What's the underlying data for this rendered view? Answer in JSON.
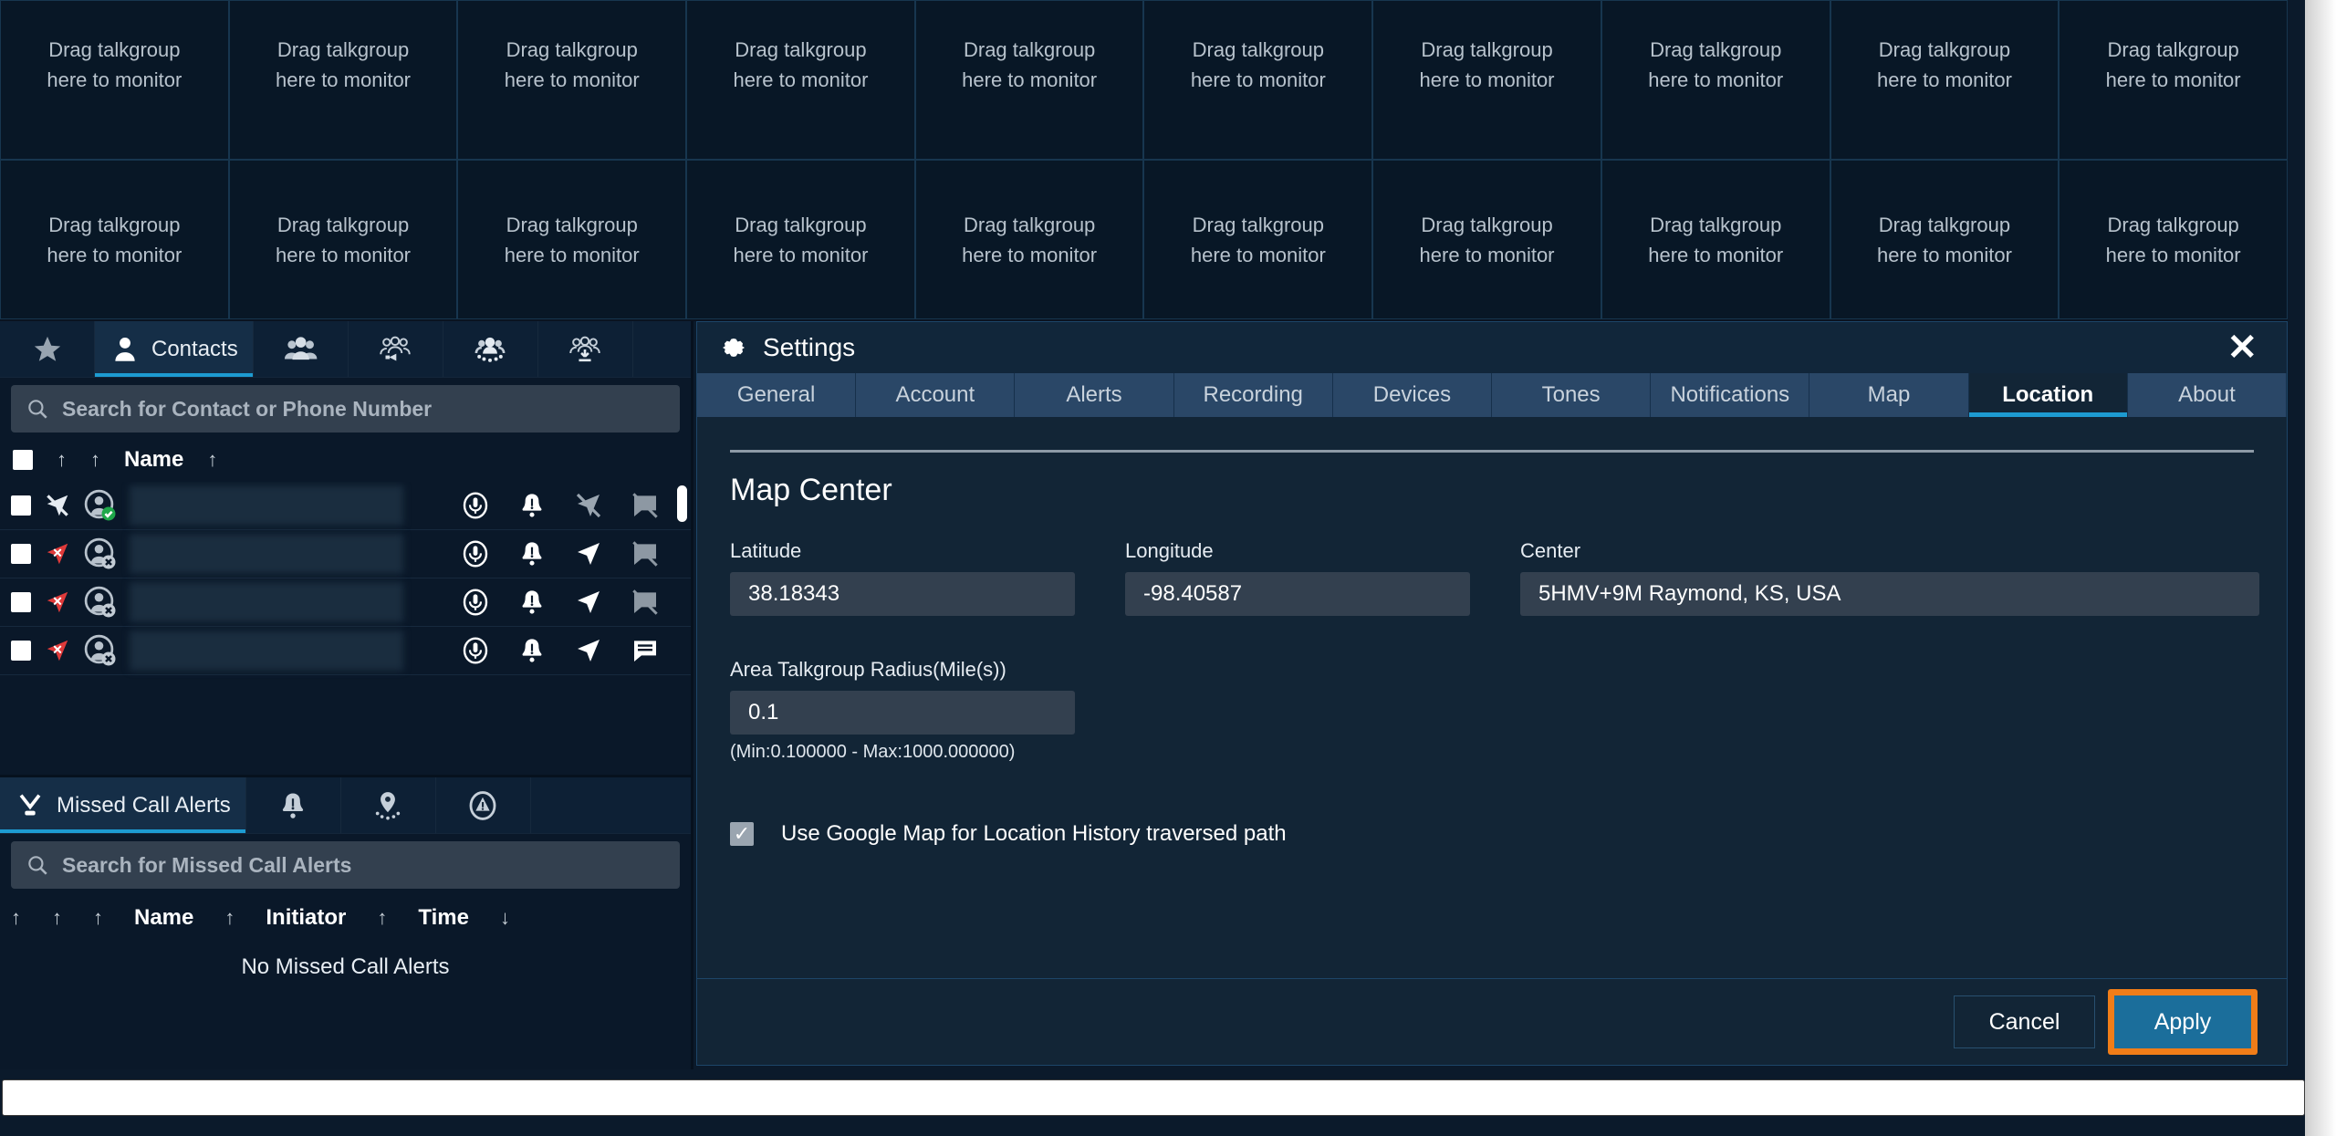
{
  "talkgroup_grid": {
    "placeholder_line1": "Drag talkgroup",
    "placeholder_line2": "here to monitor",
    "columns": 10,
    "rows": 2
  },
  "contacts_panel": {
    "tabs": [
      {
        "label": "",
        "icon": "star-icon",
        "active": false
      },
      {
        "label": "Contacts",
        "icon": "person-icon",
        "active": true
      },
      {
        "label": "",
        "icon": "groups-icon",
        "active": false
      },
      {
        "label": "",
        "icon": "broadcast-group-icon",
        "active": false
      },
      {
        "label": "",
        "icon": "area-talkgroup-icon",
        "active": false
      },
      {
        "label": "",
        "icon": "receive-group-icon",
        "active": false
      }
    ],
    "search": {
      "placeholder": "Search for Contact or Phone Number",
      "value": "",
      "icon": "search-icon"
    },
    "columns": {
      "name": "Name",
      "sort_asc": "↑",
      "sort_desc": "↓"
    },
    "rows": [
      {
        "name": "",
        "presence": "available",
        "nav": "nav-off",
        "chat": "chat-disabled"
      },
      {
        "name": "",
        "presence": "offline",
        "nav": "nav-on",
        "chat": "chat-disabled"
      },
      {
        "name": "",
        "presence": "offline",
        "nav": "nav-on",
        "chat": "chat-disabled"
      },
      {
        "name": "",
        "presence": "offline",
        "nav": "nav-on",
        "chat": "chat-enabled"
      }
    ]
  },
  "alerts_panel": {
    "tabs": [
      {
        "label": "Missed Call Alerts",
        "icon": "missed-call-icon",
        "active": true
      },
      {
        "label": "",
        "icon": "bell-alert-icon",
        "active": false
      },
      {
        "label": "",
        "icon": "geofence-alert-icon",
        "active": false
      },
      {
        "label": "",
        "icon": "emergency-alert-icon",
        "active": false
      }
    ],
    "search": {
      "placeholder": "Search for Missed Call Alerts",
      "value": "",
      "icon": "search-icon"
    },
    "columns": {
      "name": "Name",
      "initiator": "Initiator",
      "time": "Time",
      "sort_asc": "↑",
      "sort_desc": "↓"
    },
    "empty_message": "No Missed Call Alerts"
  },
  "settings": {
    "title": "Settings",
    "gear_icon": "gear-icon",
    "close_icon": "close-icon",
    "close_label": "✕",
    "tabs": [
      {
        "label": "General",
        "active": false
      },
      {
        "label": "Account",
        "active": false
      },
      {
        "label": "Alerts",
        "active": false
      },
      {
        "label": "Recording",
        "active": false
      },
      {
        "label": "Devices",
        "active": false
      },
      {
        "label": "Tones",
        "active": false
      },
      {
        "label": "Notifications",
        "active": false
      },
      {
        "label": "Map",
        "active": false
      },
      {
        "label": "Location",
        "active": true
      },
      {
        "label": "About",
        "active": false
      }
    ],
    "location": {
      "section_title": "Map Center",
      "latitude": {
        "label": "Latitude",
        "value": "38.18343"
      },
      "longitude": {
        "label": "Longitude",
        "value": "-98.40587"
      },
      "center": {
        "label": "Center",
        "value": "5HMV+9M Raymond, KS, USA"
      },
      "radius": {
        "label": "Area Talkgroup Radius(Mile(s))",
        "value": "0.1",
        "hint": "(Min:0.100000 - Max:1000.000000)"
      },
      "google_map_checkbox": {
        "label": "Use Google Map for Location History traversed path",
        "checked": true,
        "check_glyph": "✓"
      }
    },
    "footer": {
      "cancel_label": "Cancel",
      "apply_label": "Apply",
      "apply_highlight_color": "#f07d18"
    }
  },
  "colors": {
    "window_bg": "#0b1a2b",
    "panel_bg": "#0a1829",
    "dialog_bg": "#122536",
    "tab_inactive": "#2a4767",
    "accent": "#1d9bd1",
    "input_bg": "#33404f",
    "apply_bg": "#1b6e9b",
    "highlight": "#f07d18"
  }
}
